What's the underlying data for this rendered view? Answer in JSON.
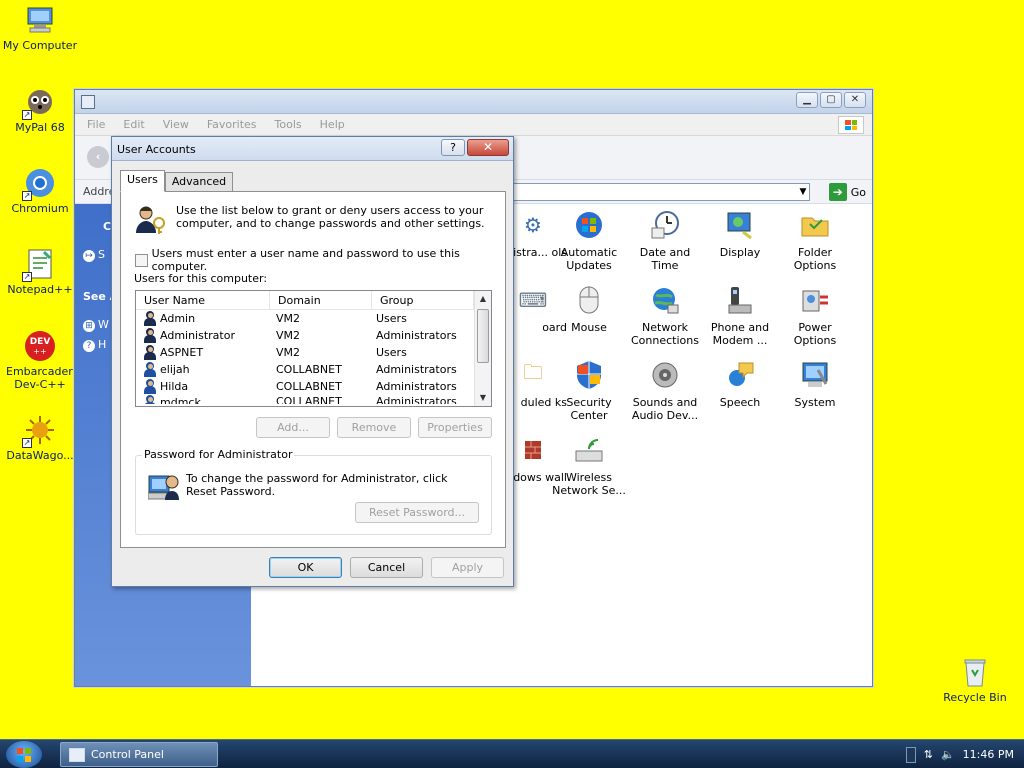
{
  "desktop": {
    "icons": [
      {
        "label": "My Computer"
      },
      {
        "label": "MyPal 68"
      },
      {
        "label": "Chromium"
      },
      {
        "label": "Notepad++"
      },
      {
        "label": "Embarcadero Dev-C++"
      },
      {
        "label": "DataWago..."
      },
      {
        "label": "Recycle Bin"
      }
    ]
  },
  "control_panel": {
    "menu": [
      "File",
      "Edit",
      "View",
      "Favorites",
      "Tools",
      "Help"
    ],
    "address_label": "Addre",
    "go_label": "Go",
    "left_pane": {
      "heading_1": "C",
      "item_1": "S",
      "heading_2": "See A",
      "item_2": "W",
      "item_3": "H"
    },
    "items": [
      {
        "label": "istra... ols"
      },
      {
        "label": "Automatic Updates"
      },
      {
        "label": "Date and Time"
      },
      {
        "label": "Display"
      },
      {
        "label": "Folder Options"
      },
      {
        "label": "oard"
      },
      {
        "label": "Mouse"
      },
      {
        "label": "Network Connections"
      },
      {
        "label": "Phone and Modem ..."
      },
      {
        "label": "Power Options"
      },
      {
        "label": "duled ks"
      },
      {
        "label": "Security Center"
      },
      {
        "label": "Sounds and Audio Dev..."
      },
      {
        "label": "Speech"
      },
      {
        "label": "System"
      },
      {
        "label": "dows wall"
      },
      {
        "label": "Wireless Network Se..."
      }
    ]
  },
  "dialog": {
    "title": "User Accounts",
    "help_glyph": "?",
    "close_glyph": "✕",
    "tabs": [
      "Users",
      "Advanced"
    ],
    "intro": "Use the list below to grant or deny users access to your computer, and to change passwords and other settings.",
    "require_login_label": "Users must enter a user name and password to use this computer.",
    "users_label": "Users for this computer:",
    "columns": [
      "User Name",
      "Domain",
      "Group"
    ],
    "users": [
      {
        "name": "Admin",
        "domain": "VM2",
        "group": "Users"
      },
      {
        "name": "Administrator",
        "domain": "VM2",
        "group": "Administrators"
      },
      {
        "name": "ASPNET",
        "domain": "VM2",
        "group": "Users"
      },
      {
        "name": "elijah",
        "domain": "COLLABNET",
        "group": "Administrators"
      },
      {
        "name": "Hilda",
        "domain": "COLLABNET",
        "group": "Administrators"
      },
      {
        "name": "mdmck",
        "domain": "COLLABNET",
        "group": "Administrators"
      }
    ],
    "buttons": {
      "add": "Add...",
      "remove": "Remove",
      "properties": "Properties"
    },
    "password_group_title": "Password for Administrator",
    "password_text": "To change the password for Administrator, click Reset Password.",
    "reset_password": "Reset Password...",
    "ok": "OK",
    "cancel": "Cancel",
    "apply": "Apply"
  },
  "taskbar": {
    "task_label": "Control Panel",
    "clock": "11:46 PM"
  }
}
